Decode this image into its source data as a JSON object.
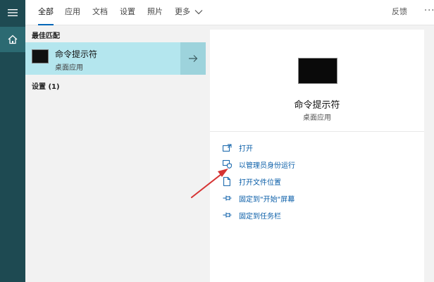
{
  "tabs": [
    {
      "label": "全部",
      "active": true
    },
    {
      "label": "应用",
      "active": false
    },
    {
      "label": "文档",
      "active": false
    },
    {
      "label": "设置",
      "active": false
    },
    {
      "label": "照片",
      "active": false
    },
    {
      "label": "更多",
      "active": false
    }
  ],
  "header": {
    "feedback": "反馈",
    "more_dots": "···"
  },
  "results": {
    "best_match_heading": "最佳匹配",
    "best_item": {
      "title": "命令提示符",
      "subtitle": "桌面应用"
    },
    "settings_heading": "设置 (1)"
  },
  "preview": {
    "title": "命令提示符",
    "subtitle": "桌面应用",
    "actions": [
      {
        "label": "打开",
        "icon": "open-icon"
      },
      {
        "label": "以管理员身份运行",
        "icon": "shield-admin-icon"
      },
      {
        "label": "打开文件位置",
        "icon": "file-location-icon"
      },
      {
        "label": "固定到\"开始\"屏幕",
        "icon": "pin-icon"
      },
      {
        "label": "固定到任务栏",
        "icon": "pin-icon"
      }
    ]
  },
  "colors": {
    "rail": "#1e4a52",
    "selected": "#b4e6ee",
    "accent": "#0a5ea8",
    "annotation_arrow": "#d63333"
  }
}
